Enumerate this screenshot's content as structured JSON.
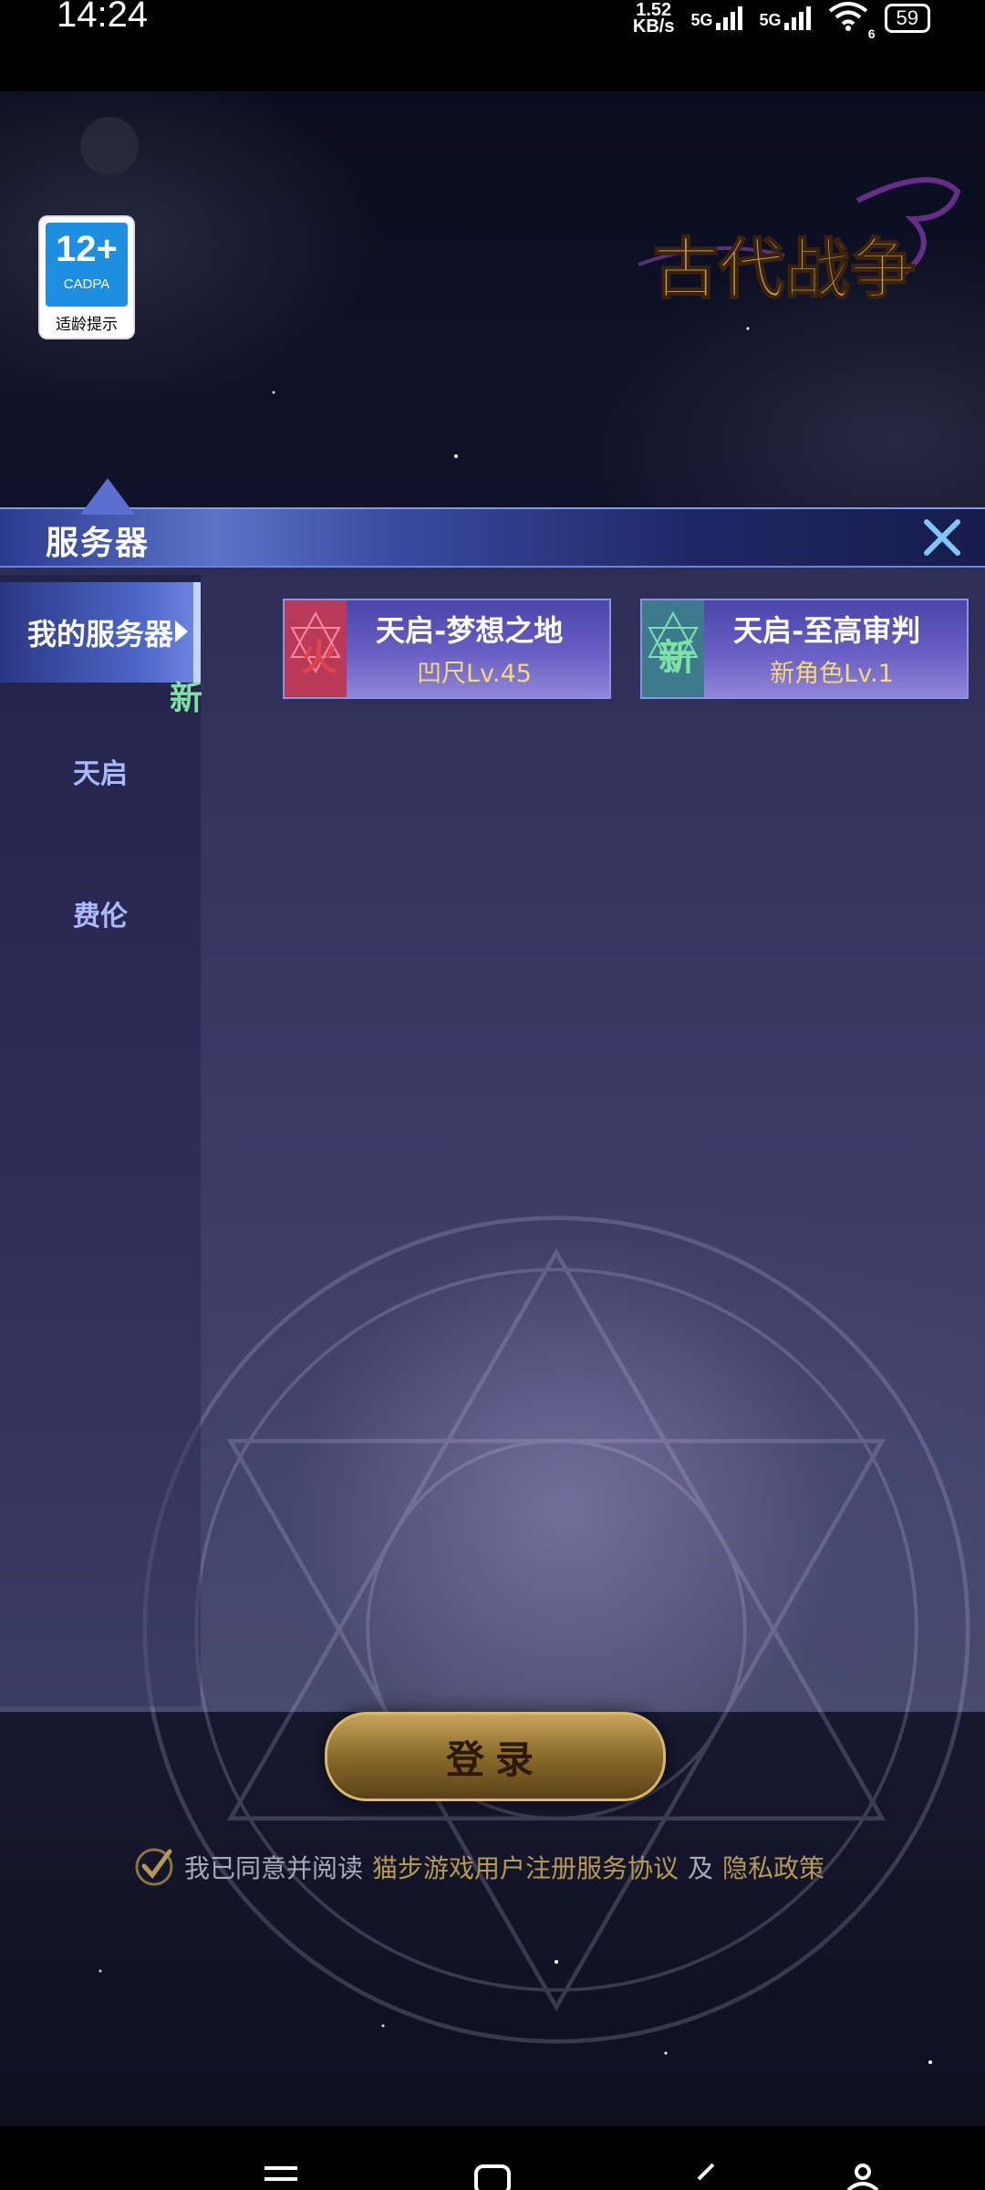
{
  "status_bar": {
    "time": "14:24",
    "net_speed_value": "1.52",
    "net_speed_unit": "KB/s",
    "sim1": "5G",
    "sim2": "5G",
    "wifi_badge": "6",
    "battery": "59"
  },
  "age_rating": {
    "age": "12+",
    "org": "CADPA",
    "tip": "适龄提示"
  },
  "logo": {
    "text": "古代战争"
  },
  "panel": {
    "title": "服务器",
    "sidebar": [
      {
        "label": "我的服务器",
        "active": true
      },
      {
        "label": "天启",
        "active": false
      },
      {
        "label": "费伦",
        "active": false
      }
    ],
    "sidebar_new_tag": "新",
    "servers": [
      {
        "badge": "火",
        "badge_color": "#e0434f",
        "name": "天启-梦想之地",
        "level": "凹尺Lv.45"
      },
      {
        "badge": "新",
        "badge_color": "#54c98c",
        "name": "天启-至高审判",
        "level": "新角色Lv.1"
      }
    ]
  },
  "login": {
    "label": "登录"
  },
  "agreement": {
    "prefix": "我已同意并阅读",
    "link1": "猫步游戏用户注册服务协议",
    "connector": "及",
    "link2": "隐私政策"
  },
  "colors": {
    "accent_gold": "#b59a52",
    "level_gold": "#f5d87a",
    "new_green": "#7de3a4"
  }
}
